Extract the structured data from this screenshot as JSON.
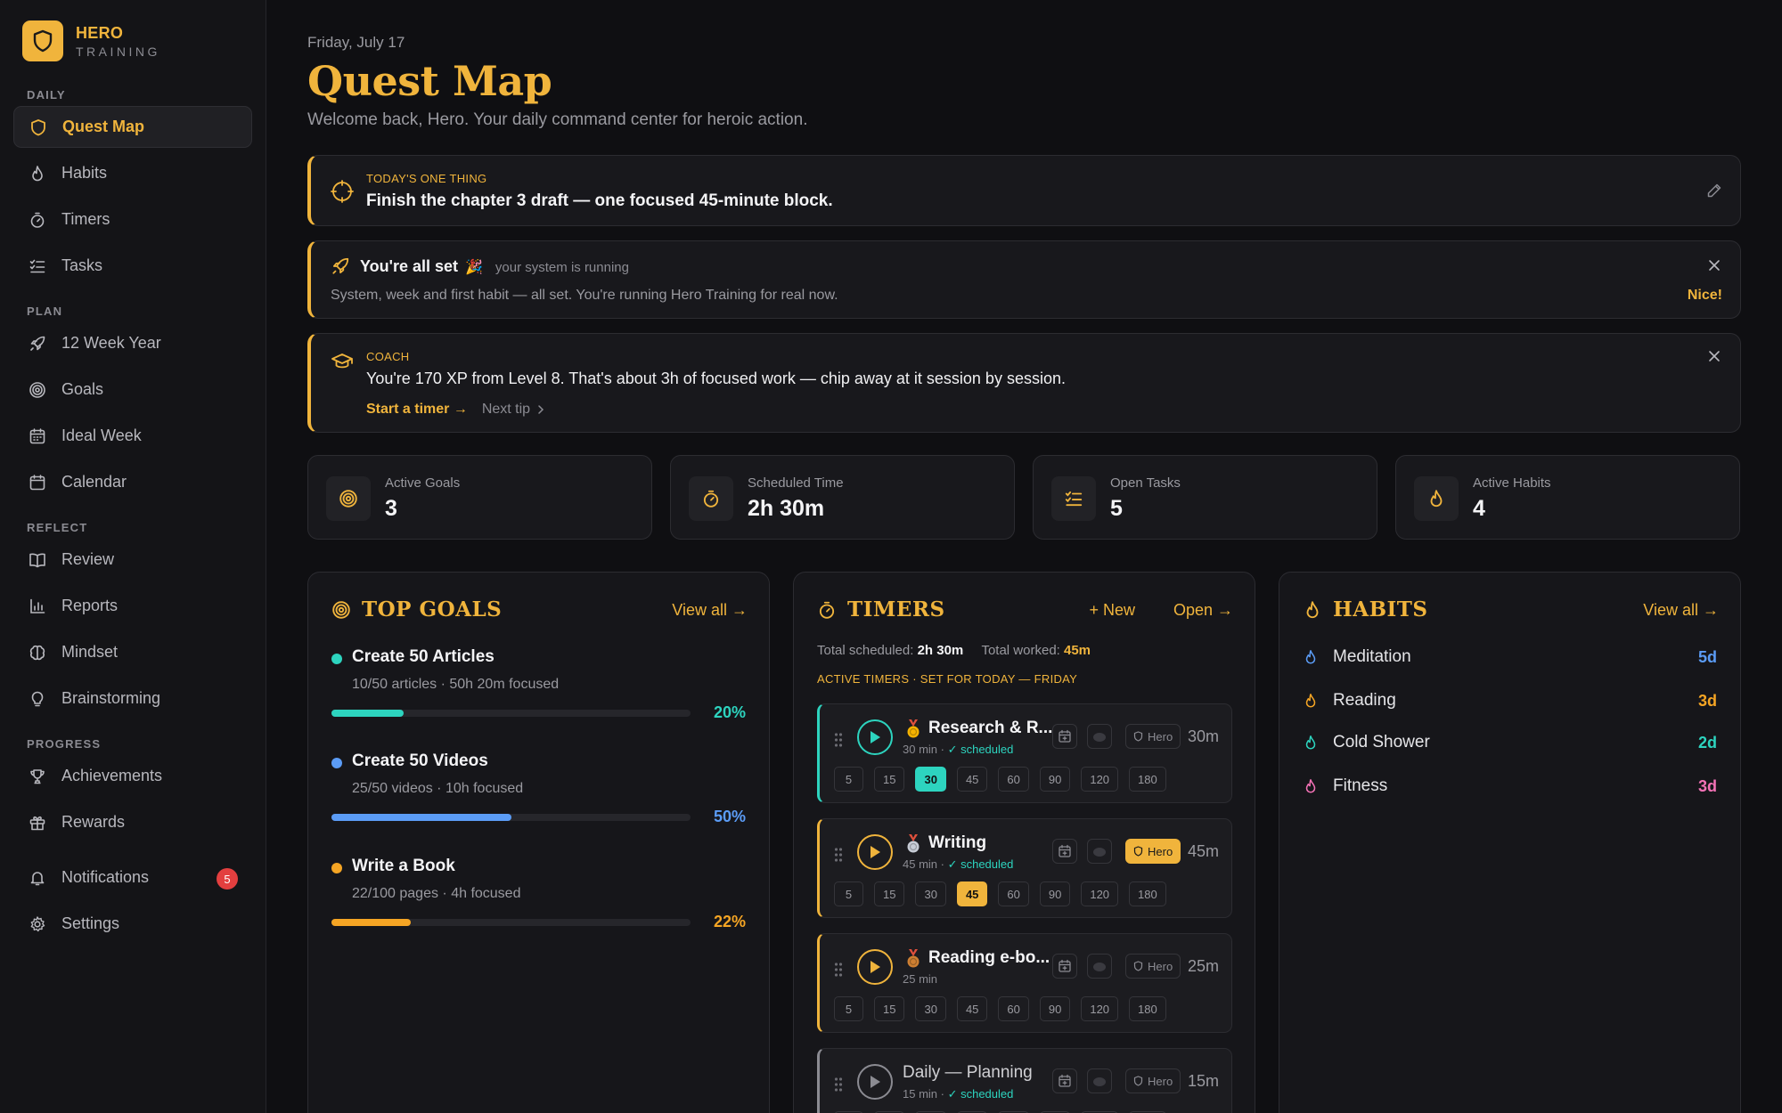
{
  "brand": {
    "title": "HERO",
    "subtitle": "TRAINING"
  },
  "sidebar": {
    "sections": [
      {
        "label": "DAILY",
        "items": [
          {
            "label": "Quest Map",
            "icon": "shield-icon",
            "active": true
          },
          {
            "label": "Habits",
            "icon": "flame-icon"
          },
          {
            "label": "Timers",
            "icon": "stopwatch-icon"
          },
          {
            "label": "Tasks",
            "icon": "checklist-icon"
          }
        ]
      },
      {
        "label": "PLAN",
        "items": [
          {
            "label": "12 Week Year",
            "icon": "rocket-icon"
          },
          {
            "label": "Goals",
            "icon": "target-icon"
          },
          {
            "label": "Ideal Week",
            "icon": "calendar-grid-icon"
          },
          {
            "label": "Calendar",
            "icon": "calendar-icon"
          }
        ]
      },
      {
        "label": "REFLECT",
        "items": [
          {
            "label": "Review",
            "icon": "book-icon"
          },
          {
            "label": "Reports",
            "icon": "bar-chart-icon"
          },
          {
            "label": "Mindset",
            "icon": "brain-icon"
          },
          {
            "label": "Brainstorming",
            "icon": "lightbulb-icon"
          }
        ]
      },
      {
        "label": "PROGRESS",
        "items": [
          {
            "label": "Achievements",
            "icon": "trophy-icon"
          },
          {
            "label": "Rewards",
            "icon": "gift-icon"
          }
        ]
      }
    ],
    "notifications": {
      "label": "Notifications",
      "count": "5"
    },
    "settings": {
      "label": "Settings"
    }
  },
  "header": {
    "date": "Friday, July 17",
    "title": "Quest Map",
    "subtitle": "Welcome back, Hero. Your daily command center for heroic action."
  },
  "one_thing": {
    "label": "TODAY'S ONE THING",
    "text": "Finish the chapter 3 draft — one focused 45-minute block."
  },
  "all_set": {
    "title": "You're all set",
    "emoji": "🎉",
    "note": "your system is running",
    "body": "System, week and first habit — all set. You're running Hero Training for real now.",
    "action": "Nice!"
  },
  "coach": {
    "label": "COACH",
    "text": "You're 170 XP from Level 8. That's about 3h of focused work — chip away at it session by session.",
    "primary_action": "Start a timer →",
    "secondary_action": "Next tip"
  },
  "stats": [
    {
      "label": "Active Goals",
      "value": "3",
      "icon": "target-icon"
    },
    {
      "label": "Scheduled Time",
      "value": "2h 30m",
      "icon": "stopwatch-icon"
    },
    {
      "label": "Open Tasks",
      "value": "5",
      "icon": "checklist-icon"
    },
    {
      "label": "Active Habits",
      "value": "4",
      "icon": "flame-icon"
    }
  ],
  "goals": {
    "title": "TOP GOALS",
    "view_all": "View all →",
    "items": [
      {
        "name": "Create 50 Articles",
        "meta": "10/50 articles · 50h 20m focused",
        "percent_label": "20%",
        "progress": 0.2,
        "color": "#2dd4bf"
      },
      {
        "name": "Create 50 Videos",
        "meta": "25/50 videos · 10h focused",
        "percent_label": "50%",
        "progress": 0.5,
        "color": "#5b9cf6"
      },
      {
        "name": "Write a Book",
        "meta": "22/100 pages · 4h focused",
        "percent_label": "22%",
        "progress": 0.22,
        "color": "#f5a524"
      }
    ]
  },
  "timers": {
    "title": "TIMERS",
    "new_label": "+ New",
    "open_label": "Open →",
    "totals": {
      "scheduled_label": "Total scheduled:",
      "scheduled_value": "2h 30m",
      "worked_label": "Total worked:",
      "worked_value": "45m"
    },
    "section_label": "ACTIVE TIMERS · SET FOR TODAY — FRIDAY",
    "presets": [
      "5",
      "15",
      "30",
      "45",
      "60",
      "90",
      "120",
      "180"
    ],
    "items": [
      {
        "name": "Research & R...",
        "medal": "gold-medal-icon",
        "duration_meta": "30 min",
        "scheduled": "✓ scheduled",
        "hero": "Hero",
        "hero_on": false,
        "duration": "30m",
        "selected": "30",
        "accent": "#2dd4bf"
      },
      {
        "name": "Writing",
        "medal": "silver-medal-icon",
        "duration_meta": "45 min",
        "scheduled": "✓ scheduled",
        "hero": "Hero",
        "hero_on": true,
        "duration": "45m",
        "selected": "45",
        "accent": "#f0b43c"
      },
      {
        "name": "Reading e-bo...",
        "medal": "bronze-medal-icon",
        "duration_meta": "25 min",
        "scheduled": "",
        "hero": "Hero",
        "hero_on": false,
        "duration": "25m",
        "selected": "",
        "accent": "#f0b43c"
      },
      {
        "name": "Daily — Planning",
        "medal": "",
        "duration_meta": "15 min",
        "scheduled": "✓ scheduled",
        "hero": "Hero",
        "hero_on": false,
        "duration": "15m",
        "selected": "",
        "accent": "#8b8b92"
      }
    ]
  },
  "habits": {
    "title": "HABITS",
    "view_all": "View all →",
    "items": [
      {
        "name": "Meditation",
        "streak": "5d",
        "color": "#5b9cf6"
      },
      {
        "name": "Reading",
        "streak": "3d",
        "color": "#f5a524"
      },
      {
        "name": "Cold Shower",
        "streak": "2d",
        "color": "#2dd4bf"
      },
      {
        "name": "Fitness",
        "streak": "3d",
        "color": "#f472b6"
      }
    ]
  }
}
